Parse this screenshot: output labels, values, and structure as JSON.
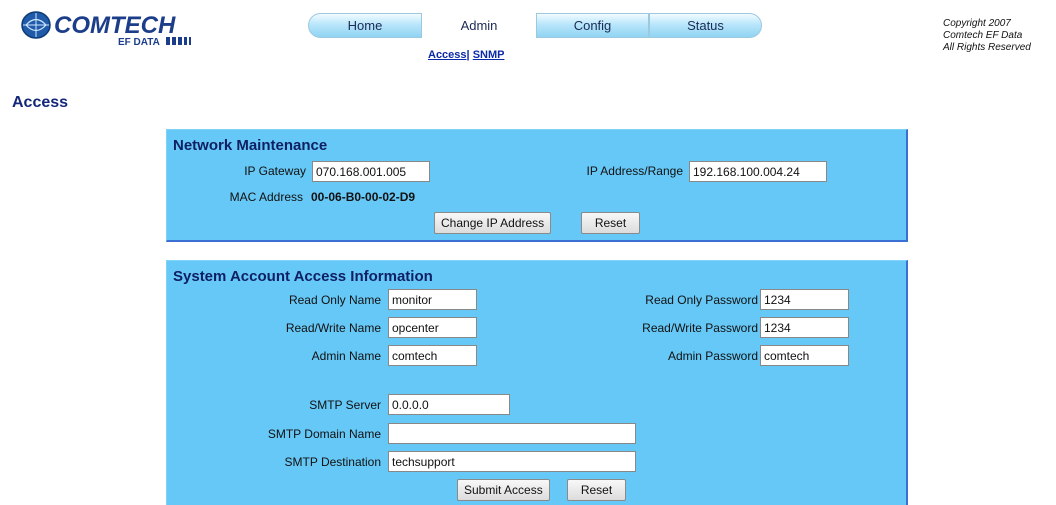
{
  "header": {
    "logo_text": "COMTECH",
    "logo_sub": "EF DATA",
    "copyright_lines": [
      "Copyright 2007",
      "Comtech EF Data",
      "All Rights Reserved"
    ]
  },
  "nav": {
    "tabs": [
      {
        "label": "Home",
        "active": false
      },
      {
        "label": "Admin",
        "active": true
      },
      {
        "label": "Config",
        "active": false
      },
      {
        "label": "Status",
        "active": false
      }
    ],
    "sublinks": [
      "Access|",
      "SNMP"
    ]
  },
  "page": {
    "title": "Access"
  },
  "network": {
    "title": "Network Maintenance",
    "gateway_label": "IP Gateway",
    "gateway_value": "070.168.001.005",
    "ip_label": "IP Address/Range",
    "ip_value": "192.168.100.004.24",
    "mac_label": "MAC Address",
    "mac_value": "00-06-B0-00-02-D9",
    "change_button": "Change IP Address",
    "reset_button": "Reset"
  },
  "accounts": {
    "title": "System Account Access Information",
    "read_only_name_label": "Read Only Name",
    "read_only_name": "monitor",
    "read_only_password_label": "Read Only Password",
    "read_only_password": "1234",
    "read_write_name_label": "Read/Write Name",
    "read_write_name": "opcenter",
    "read_write_password_label": "Read/Write Password",
    "read_write_password": "1234",
    "admin_name_label": "Admin Name",
    "admin_name": "comtech",
    "admin_password_label": "Admin Password",
    "admin_password": "comtech",
    "smtp_server_label": "SMTP Server",
    "smtp_server": "0.0.0.0",
    "smtp_domain_label": "SMTP Domain Name",
    "smtp_domain": "",
    "smtp_destination_label": "SMTP Destination",
    "smtp_destination": "techsupport",
    "submit_button": "Submit Access",
    "reset_button": "Reset"
  },
  "colors": {
    "panel": "#66c8f6",
    "panel_border": "#3c6fd3",
    "title": "#14287a",
    "link": "#0a2aa8"
  }
}
